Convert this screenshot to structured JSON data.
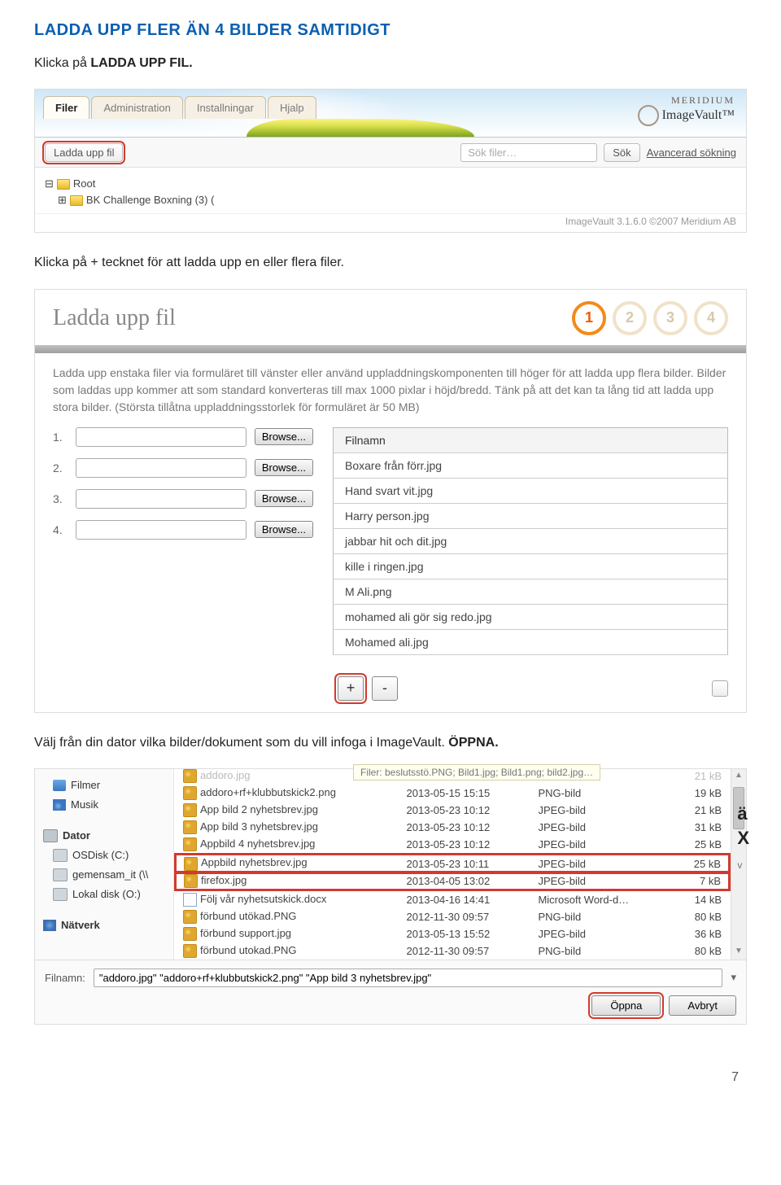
{
  "doc": {
    "heading": "LADDA UPP FLER ÄN 4 BILDER SAMTIDIGT",
    "p1_lead": "Klicka på ",
    "p1_bold": "LADDA UPP FIL.",
    "p2": "Klicka på + tecknet för att ladda upp en eller flera filer.",
    "p3_lead": "Välj från din dator vilka bilder/dokument som du vill infoga i ImageVault. ",
    "p3_bold": "ÖPPNA.",
    "page_number": "7"
  },
  "s1": {
    "tabs": [
      "Filer",
      "Administration",
      "Installningar",
      "Hjalp"
    ],
    "upload_btn": "Ladda upp fil",
    "search_placeholder": "Sök filer…",
    "search_btn": "Sök",
    "adv_search": "Avancerad sökning",
    "tree_root": "Root",
    "tree_child": "BK Challenge  Boxning (3) (",
    "footer": "ImageVault 3.1.6.0 ©2007 Meridium AB",
    "logo_brand": "MERIDIUM",
    "logo_prod": "ImageVault™"
  },
  "s2": {
    "title": "Ladda upp fil",
    "steps": [
      "1",
      "2",
      "3",
      "4"
    ],
    "desc": "Ladda upp enstaka filer via formuläret till vänster eller använd uppladdningskomponenten till höger för att ladda upp flera bilder. Bilder som laddas upp kommer att som standard konverteras till max 1000 pixlar i höjd/bredd. Tänk på att det kan ta lång tid att ladda upp stora bilder.  (Största tillåtna uppladdningsstorlek för formuläret är 50 MB)",
    "rows": [
      "1.",
      "2.",
      "3.",
      "4."
    ],
    "browse": "Browse...",
    "filecol": "Filnamn",
    "files": [
      "Boxare från förr.jpg",
      "Hand svart vit.jpg",
      "Harry person.jpg",
      "jabbar hit och dit.jpg",
      "kille i ringen.jpg",
      "M Ali.png",
      "mohamed ali gör sig redo.jpg",
      "Mohamed ali.jpg"
    ],
    "plus": "+",
    "minus": "-"
  },
  "s3": {
    "nav": {
      "filmer": "Filmer",
      "musik": "Musik",
      "dator": "Dator",
      "os": "OSDisk (C:)",
      "gemensam": "gemensam_it (\\\\",
      "lokal": "Lokal disk (O:)",
      "natverk": "Nätverk"
    },
    "filter_label": "Filer: beslutsstö.PNG; Bild1.jpg; Bild1.png; bild2.jpg…",
    "rows": [
      {
        "n": "addoro.jpg",
        "d": "",
        "t": "",
        "s": "21 kB",
        "ghost": true
      },
      {
        "n": "addoro+rf+klubbutskick2.png",
        "d": "2013-05-15 15:15",
        "t": "PNG-bild",
        "s": "19 kB"
      },
      {
        "n": "App bild 2 nyhetsbrev.jpg",
        "d": "2013-05-23 10:12",
        "t": "JPEG-bild",
        "s": "21 kB"
      },
      {
        "n": "App bild 3 nyhetsbrev.jpg",
        "d": "2013-05-23 10:12",
        "t": "JPEG-bild",
        "s": "31 kB"
      },
      {
        "n": "Appbild 4 nyhetsbrev.jpg",
        "d": "2013-05-23 10:12",
        "t": "JPEG-bild",
        "s": "25 kB"
      },
      {
        "n": "Appbild nyhetsbrev.jpg",
        "d": "2013-05-23 10:11",
        "t": "JPEG-bild",
        "s": "25 kB",
        "hl": true
      },
      {
        "n": "firefox.jpg",
        "d": "2013-04-05 13:02",
        "t": "JPEG-bild",
        "s": "7 kB",
        "hl": true
      },
      {
        "n": "Följ vår nyhetsutskick.docx",
        "d": "2013-04-16 14:41",
        "t": "Microsoft Word-d…",
        "s": "14 kB",
        "doc": true
      },
      {
        "n": "förbund utökad.PNG",
        "d": "2012-11-30 09:57",
        "t": "PNG-bild",
        "s": "80 kB"
      },
      {
        "n": "förbund support.jpg",
        "d": "2013-05-13 15:52",
        "t": "JPEG-bild",
        "s": "36 kB"
      },
      {
        "n": "förbund utokad.PNG",
        "d": "2012-11-30 09:57",
        "t": "PNG-bild",
        "s": "80 kB"
      }
    ],
    "filename_label": "Filnamn:",
    "filename_value": "\"addoro.jpg\" \"addoro+rf+klubbutskick2.png\" \"App bild 3 nyhetsbrev.jpg\"",
    "open": "Öppna",
    "cancel": "Avbryt"
  }
}
